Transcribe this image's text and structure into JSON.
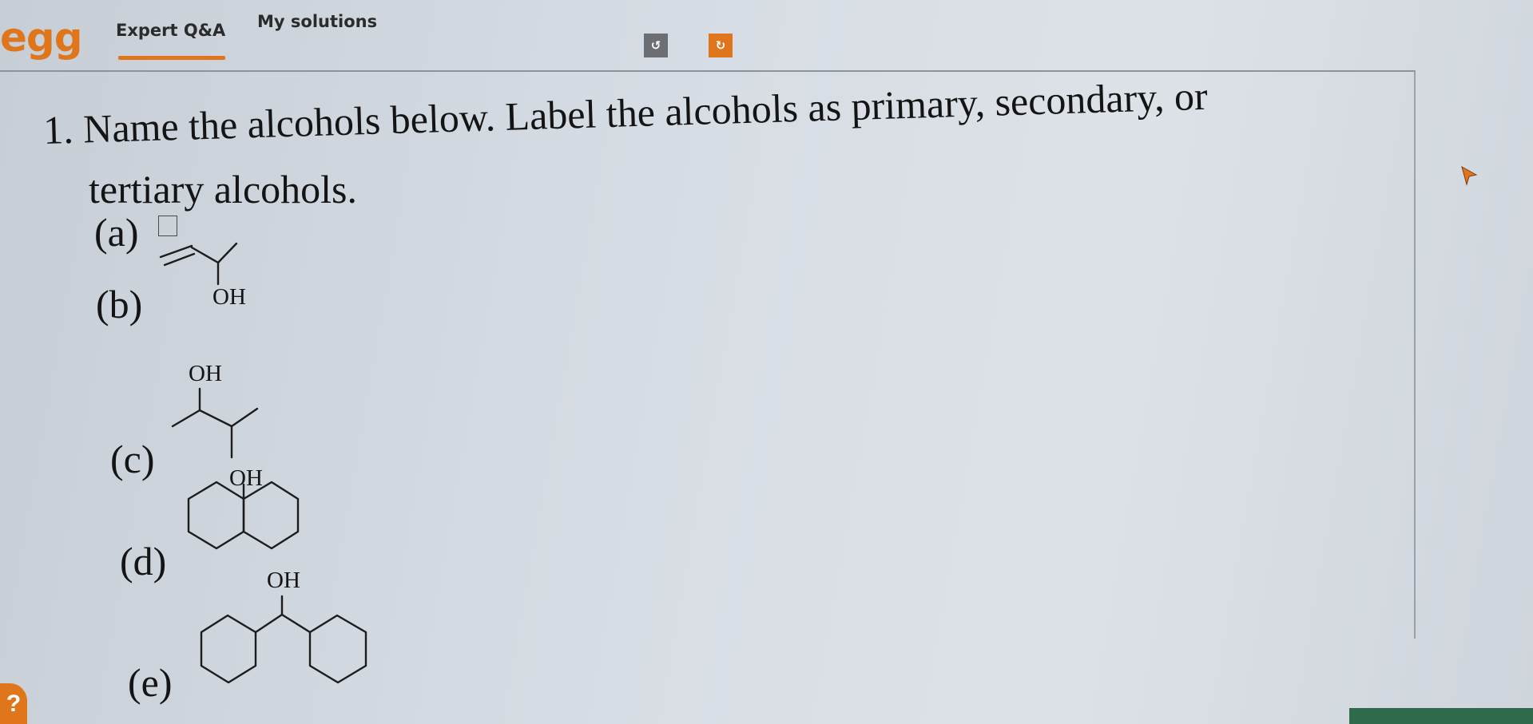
{
  "header": {
    "logo_text": "egg",
    "tabs": [
      {
        "label": "Expert Q&A",
        "active": true
      },
      {
        "label": "My solutions",
        "active": false
      }
    ],
    "toolbar": [
      {
        "icon": "undo-icon",
        "glyph": "↺",
        "color": "#6b6f73"
      },
      {
        "icon": "redo-icon",
        "glyph": "↻",
        "color": "#e0761c"
      }
    ]
  },
  "question": {
    "line1": "1. Name the alcohols below. Label the alcohols as primary, secondary, or",
    "line2": "tertiary alcohols."
  },
  "parts": [
    {
      "label": "(a)"
    },
    {
      "label": "(b)",
      "substituent": "OH"
    },
    {
      "label": "(c)",
      "substituents": [
        "OH",
        "OH"
      ]
    },
    {
      "label": "(d)",
      "substituent": "OH"
    },
    {
      "label": "(e)",
      "substituent": "OH"
    }
  ],
  "help": {
    "label": "?"
  },
  "colors": {
    "accent": "#e0761c",
    "text": "#141414"
  }
}
